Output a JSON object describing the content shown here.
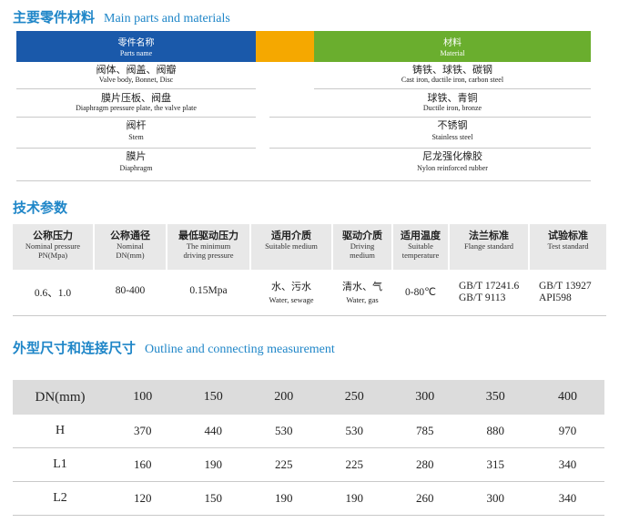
{
  "section1": {
    "title_cn": "主要零件材料",
    "title_en": "Main parts and materials"
  },
  "parts_header": {
    "col1_cn": "零件名称",
    "col1_en": "Parts name",
    "col2_cn": "材料",
    "col2_en": "Material"
  },
  "parts_rows": [
    {
      "name_cn": "阀体、阀盖、阀瓣",
      "name_en": "Valve body, Bonnet, Disc",
      "mat_cn": "铸铁、球铁、碳钢",
      "mat_en": "Cast iron, ductile iron, carbon steel"
    },
    {
      "name_cn": "膜片压板、阀盘",
      "name_en": "Diaphragm pressure plate, the valve plate",
      "mat_cn": "球铁、青铜",
      "mat_en": "Ductile iron, bronze"
    },
    {
      "name_cn": "阀杆",
      "name_en": "Stem",
      "mat_cn": "不锈钢",
      "mat_en": "Stainless steel"
    },
    {
      "name_cn": "膜片",
      "name_en": "Diaphragm",
      "mat_cn": "尼龙强化橡胶",
      "mat_en": "Nylon reinforced rubber"
    }
  ],
  "section2": {
    "title_cn": "技术参数"
  },
  "tech_header": [
    {
      "cn": "公称压力",
      "en1": "Nominal pressure",
      "en2": "PN(Mpa)"
    },
    {
      "cn": "公称通径",
      "en1": "Nominal",
      "en2": "DN(mm)"
    },
    {
      "cn": "最低驱动压力",
      "en1": "The minimum",
      "en2": "driving pressure"
    },
    {
      "cn": "适用介质",
      "en1": "Suitable medium",
      "en2": ""
    },
    {
      "cn": "驱动介质",
      "en1": "Driving",
      "en2": "medium"
    },
    {
      "cn": "适用温度",
      "en1": "Suitable",
      "en2": "temperature"
    },
    {
      "cn": "法兰标准",
      "en1": "Flange standard",
      "en2": ""
    },
    {
      "cn": "试验标准",
      "en1": "Test standard",
      "en2": ""
    }
  ],
  "tech_values": {
    "pressure": "0.6、1.0",
    "dn": "80-400",
    "min_pressure": "0.15Mpa",
    "medium_cn": "水、污水",
    "medium_en": "Water, sewage",
    "drive_cn": "清水、气",
    "drive_en": "Water, gas",
    "temp": "0-80℃",
    "flange1": "GB/T 17241.6",
    "flange2": "GB/T 9113",
    "test1": "GB/T 13927",
    "test2": "API598"
  },
  "section3": {
    "title_cn": "外型尺寸和连接尺寸",
    "title_en": "Outline and connecting measurement"
  },
  "dims": {
    "header": [
      "DN(mm)",
      "100",
      "150",
      "200",
      "250",
      "300",
      "350",
      "400"
    ],
    "rows": [
      [
        "H",
        "370",
        "440",
        "530",
        "530",
        "785",
        "880",
        "970"
      ],
      [
        "L1",
        "160",
        "190",
        "225",
        "225",
        "280",
        "315",
        "340"
      ],
      [
        "L2",
        "120",
        "150",
        "190",
        "190",
        "260",
        "300",
        "340"
      ]
    ]
  }
}
